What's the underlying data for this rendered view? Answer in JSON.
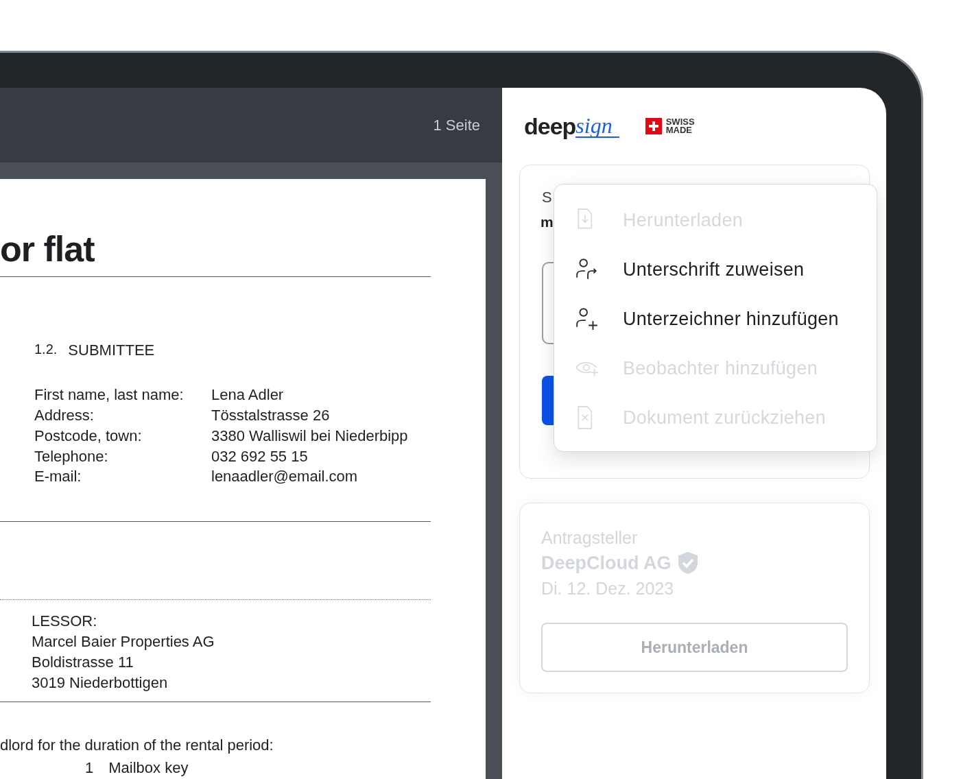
{
  "toolbar": {
    "page_count": "1 Seite"
  },
  "document": {
    "title": "or flat",
    "section_number": "1.2.",
    "section_title": "SUBMITTEE",
    "fields": [
      {
        "label": "First name, last name:",
        "value": "Lena Adler"
      },
      {
        "label": "Address:",
        "value": "Tösstalstrasse 26"
      },
      {
        "label": "Postcode, town:",
        "value": "3380 Walliswil bei Niederbipp"
      },
      {
        "label": "Telephone:",
        "value": "032 692 55 15"
      },
      {
        "label": "E-mail:",
        "value": "lenaadler@email.com"
      }
    ],
    "lessor": [
      "LESSOR:",
      "Marcel Baier Properties AG",
      "Boldistrasse 11",
      "3019 Niederbottigen"
    ],
    "keys_intro": "dlord for the duration of the rental period:",
    "keys": [
      {
        "count": "1",
        "name": "Mailbox key"
      }
    ]
  },
  "brand": {
    "logo_plain": "deep",
    "logo_script": "sign",
    "badge_line_1": "SWISS",
    "badge_line_2": "MADE"
  },
  "signer_card": {
    "label": "S",
    "name": "m"
  },
  "menu": [
    {
      "kind": "download",
      "label": "Herunterladen",
      "disabled": true
    },
    {
      "kind": "assign",
      "label": "Unterschrift zuweisen",
      "disabled": false
    },
    {
      "kind": "add_signer",
      "label": "Unterzeichner hinzufügen",
      "disabled": false
    },
    {
      "kind": "add_observer",
      "label": "Beobachter hinzufügen",
      "disabled": true
    },
    {
      "kind": "withdraw",
      "label": "Dokument zurückziehen",
      "disabled": true
    }
  ],
  "requester_card": {
    "label": "Antragsteller",
    "name": "DeepCloud AG",
    "verified": true,
    "date": "Di. 12. Dez. 2023",
    "button": "Herunterladen"
  }
}
